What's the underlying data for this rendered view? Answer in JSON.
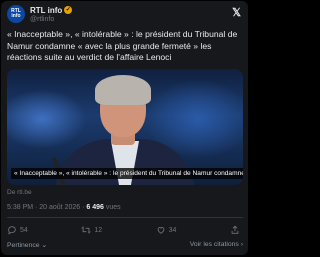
{
  "account": {
    "avatar_line1": "RTL",
    "avatar_line2": "info",
    "name": "RTL info",
    "handle": "@rtlinfo"
  },
  "tweet": {
    "text": "« Inacceptable », « intolérable » : le président du Tribunal de Namur condamne « avec la plus grande fermeté » les réactions suite au verdict de l'affaire Lenoci",
    "caption": "« Inacceptable », « intolérable » : le président du Tribunal de Namur condamne ...",
    "source": "De rtl.be",
    "time": "5:38 PM · 20 août 2026 · ",
    "views_count": "6 496",
    "views_label": " vues"
  },
  "actions": {
    "replies": "54",
    "retweets": "12",
    "likes": "34"
  },
  "footer": {
    "relevance": "Pertinence",
    "citations": "Voir les citations"
  },
  "icons": [
    "x-logo-icon",
    "verified-badge-icon",
    "reply-icon",
    "retweet-icon",
    "like-icon",
    "share-icon",
    "chevron-down-icon",
    "chevron-right-icon"
  ]
}
